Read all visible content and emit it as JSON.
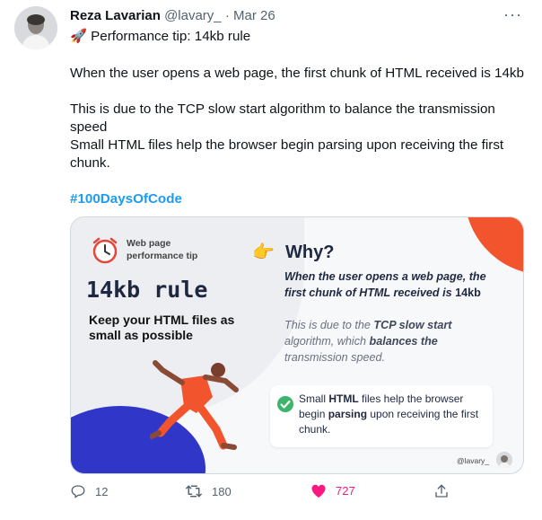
{
  "author": {
    "name": "Reza Lavarian",
    "handle": "@lavary_",
    "date": "Mar 26"
  },
  "more_glyph": "···",
  "tweet": {
    "line1": "🚀 Performance tip: 14kb rule",
    "line2": "When the user opens a web page, the first chunk of HTML received is 14kb",
    "line3": "This is due to the TCP slow start algorithm to balance the transmission speed",
    "line4": "Small HTML files help the browser begin parsing upon receiving the first chunk.",
    "hashtag": "#100DaysOfCode"
  },
  "card": {
    "tip_label": "Web page performance tip",
    "rule_title": "14kb rule",
    "rule_subtitle": "Keep your HTML files as small as possible",
    "why_title": "Why?",
    "why_bold_a": "When the user opens a web page, the first chunk of HTML received is ",
    "why_bold_b": "14kb",
    "why_n1": "This is due to the ",
    "why_n2": "TCP slow start",
    "why_n3": " algorithm, which ",
    "why_n4": "balances the",
    "why_n5": " transmission speed.",
    "check_t1": "Small ",
    "check_t2": "HTML",
    "check_t3": " files help the browser begin ",
    "check_t4": "parsing",
    "check_t5": " upon receiving the first chunk.",
    "handle": "@lavary_"
  },
  "actions": {
    "replies": "12",
    "retweets": "180",
    "likes": "727"
  },
  "colors": {
    "link": "#1d9bf0",
    "like": "#f91880",
    "muted": "#536471",
    "accent_red": "#f2542d",
    "accent_blue": "#2f36c8"
  }
}
